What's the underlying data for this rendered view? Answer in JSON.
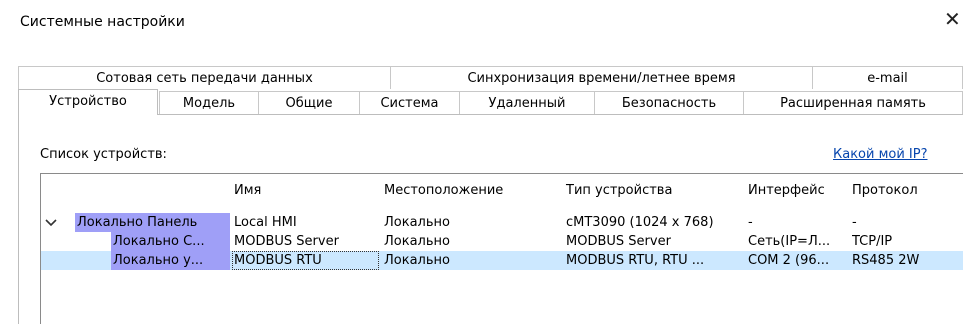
{
  "window": {
    "title": "Системные настройки",
    "close_glyph": "✕"
  },
  "tabs_back": [
    "Сотовая сеть передачи данных",
    "Синхронизация времени/летнее время",
    "e-mail"
  ],
  "tabs_front": [
    "Устройство",
    "Модель",
    "Общие",
    "Система",
    "Удаленный",
    "Безопасность",
    "Расширенная память"
  ],
  "device": {
    "list_label": "Список устройств:",
    "link": "Какой мой IP?",
    "columns": [
      "Имя",
      "Местоположение",
      "Тип устройства",
      "Интерфейс",
      "Протокол"
    ],
    "rows": [
      {
        "tree": "Локально Панель",
        "name": "Local HMI",
        "location": "Локально",
        "type": "cMT3090 (1024 x 768)",
        "interface": "-",
        "protocol": "-"
      },
      {
        "tree": "Локально С...",
        "name": "MODBUS Server",
        "location": "Локально",
        "type": "MODBUS Server",
        "interface": "Сеть(IP=Л...",
        "protocol": "TCP/IP"
      },
      {
        "tree": "Локально у...",
        "name": "MODBUS RTU",
        "location": "Локально",
        "type": "MODBUS RTU, RTU ...",
        "interface": "COM 2 (96...",
        "protocol": "RS485 2W"
      }
    ]
  },
  "colors": {
    "tree_highlight": "#9f9ff7",
    "selected_row": "#cce8ff",
    "link": "#0645ad"
  },
  "icons": {
    "expand": "chevron-down-icon",
    "close": "close-icon"
  }
}
